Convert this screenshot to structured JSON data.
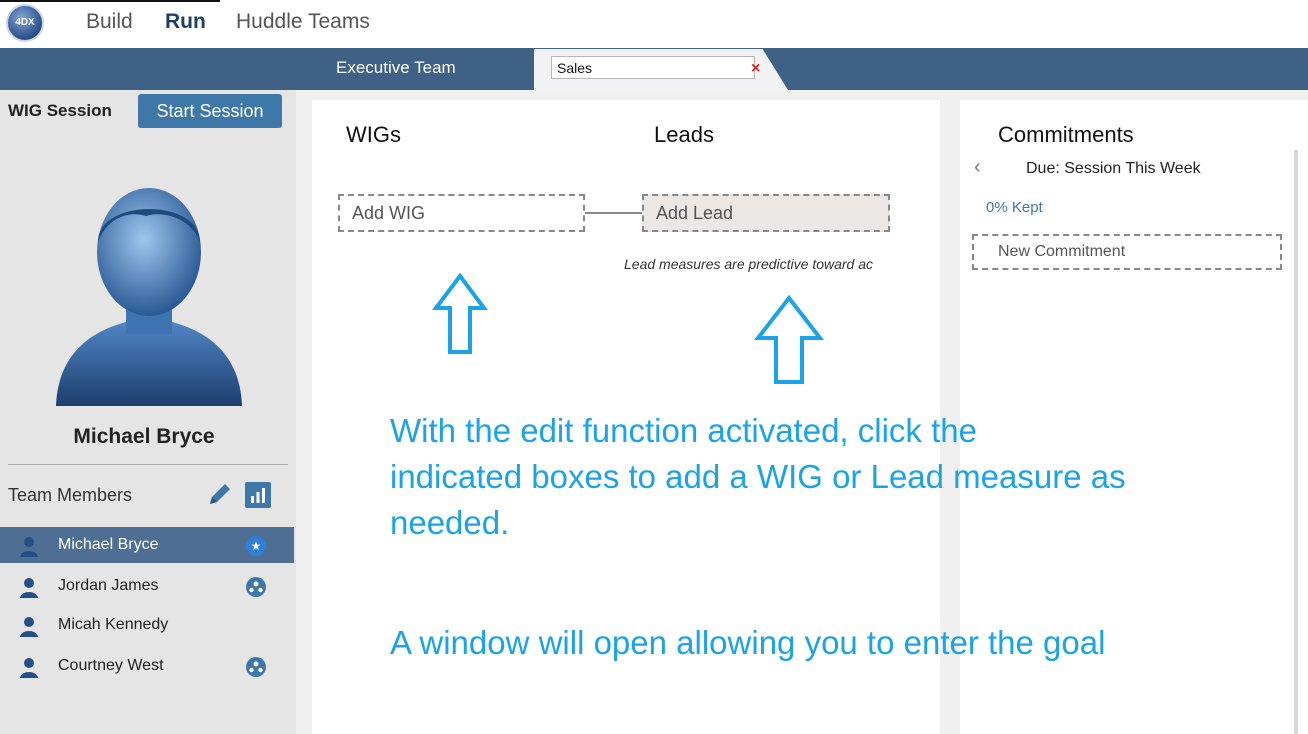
{
  "nav": {
    "logo_text": "4DX",
    "items": [
      {
        "label": "Build",
        "active": false
      },
      {
        "label": "Run",
        "active": true
      },
      {
        "label": "Huddle Teams",
        "active": false
      }
    ]
  },
  "tabs": {
    "executive": "Executive Team",
    "active_value": "Sales",
    "close_glyph": "×"
  },
  "sidebar": {
    "session_label": "WIG Session",
    "start_button": "Start Session",
    "user_name": "Michael Bryce",
    "team_members_label": "Team Members",
    "members": [
      {
        "name": "Michael Bryce",
        "selected": true,
        "badge": "★"
      },
      {
        "name": "Jordan James",
        "selected": false,
        "badge": "team"
      },
      {
        "name": "Micah Kennedy",
        "selected": false,
        "badge": ""
      },
      {
        "name": "Courtney West",
        "selected": false,
        "badge": "team"
      }
    ]
  },
  "main": {
    "wigs_heading": "WIGs",
    "leads_heading": "Leads",
    "add_wig": "Add WIG",
    "add_lead": "Add Lead",
    "lead_hint": "Lead measures are predictive toward ac"
  },
  "commitments": {
    "heading": "Commitments",
    "chevron": "‹",
    "due": "Due: Session This Week",
    "kept": "0% Kept",
    "new_commitment": "New Commitment"
  },
  "annotation": {
    "line1": "With the edit function activated, click the\nindicated boxes to add a WIG or Lead measure as\nneeded.",
    "line2": "A window will open allowing you to enter the goal"
  },
  "colors": {
    "brand_blue": "#3d78a8",
    "tab_band": "#3f6186",
    "annotation": "#1aa3e8",
    "close_red": "#e02020"
  }
}
